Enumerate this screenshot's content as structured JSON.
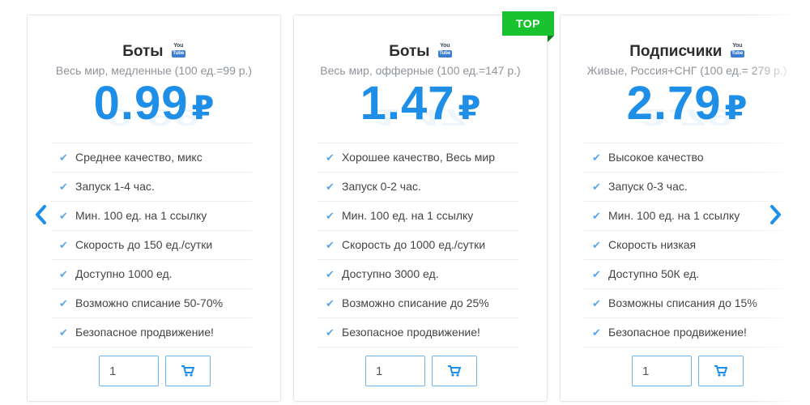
{
  "carousel": {
    "cards": [
      {
        "title": "Боты",
        "badge_top": "You",
        "badge_bottom": "Tube",
        "subtitle": "Весь мир, медленные (100 ед.=99 р.)",
        "price": "0.99",
        "currency": "₽",
        "features": [
          "Среднее качество, микс",
          "Запуск 1-4 час.",
          "Мин. 100 ед. на 1 ссылку",
          "Скорость до 150 ед./сутки",
          "Доступно 1000 ед.",
          "Возможно списание 50-70%",
          "Безопасное продвижение!"
        ],
        "quantity": "1"
      },
      {
        "title": "Боты",
        "badge_top": "You",
        "badge_bottom": "Tube",
        "subtitle": "Весь мир, офферные (100 ед.=147 р.)",
        "price": "1.47",
        "currency": "₽",
        "ribbon": "TOP",
        "features": [
          "Хорошее качество, Весь мир",
          "Запуск 0-2 час.",
          "Мин. 100 ед. на 1 ссылку",
          "Скорость до 1000 ед./сутки",
          "Доступно 3000 ед.",
          "Возможно списание до 25%",
          "Безопасное продвижение!"
        ],
        "quantity": "1"
      },
      {
        "title": "Подписчики",
        "badge_top": "You",
        "badge_bottom": "Tube",
        "subtitle": "Живые, Россия+СНГ (100 ед.= 279 р.)",
        "price": "2.79",
        "currency": "₽",
        "features": [
          "Высокое качество",
          "Запуск 0-3 час.",
          "Мин. 100 ед. на 1 ссылку",
          "Скорость низкая",
          "Доступно 50К ед.",
          "Возможны списания до 15%",
          "Безопасное продвижение!"
        ],
        "quantity": "1"
      }
    ],
    "check_icon": "✔",
    "icons": {
      "prev": "chevron-left-icon",
      "next": "chevron-right-icon",
      "cart": "cart-icon",
      "check": "check-icon",
      "badge": "youtube-icon"
    },
    "colors": {
      "price": "#1e8ee6",
      "ribbon": "#19c22f",
      "check": "#5aa7e6",
      "arrow": "#1e8ee6",
      "border": "#6cb2ec"
    }
  }
}
